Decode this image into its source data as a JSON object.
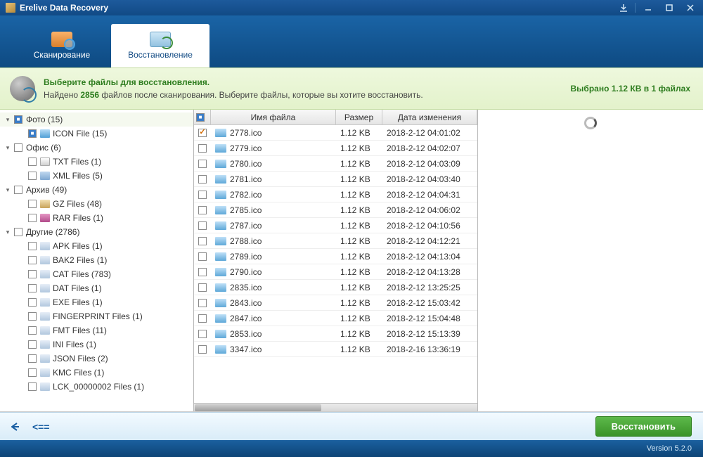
{
  "app": {
    "title": "Erelive Data Recovery",
    "version": "Version 5.2.0"
  },
  "tabs": {
    "scan": "Сканирование",
    "recover": "Восстановление"
  },
  "info": {
    "line1": "Выберите файлы для восстановления.",
    "line2a": "Найдено ",
    "count": "2856",
    "line2b": " файлов после сканирования. Выберите файлы, которые вы хотите восстановить.",
    "selected": "Выбрано 1.12 КВ в 1 файлах"
  },
  "tree": [
    {
      "level": 1,
      "exp": "▾",
      "chk": true,
      "icon": "",
      "label": "Фото (15)",
      "selected": true
    },
    {
      "level": 2,
      "exp": "",
      "chk": true,
      "icon": "ico",
      "label": "ICON File (15)"
    },
    {
      "level": 1,
      "exp": "▾",
      "chk": false,
      "icon": "",
      "label": "Офис (6)"
    },
    {
      "level": 2,
      "exp": "",
      "chk": false,
      "icon": "txt",
      "label": "TXT Files (1)"
    },
    {
      "level": 2,
      "exp": "",
      "chk": false,
      "icon": "xml",
      "label": "XML Files (5)"
    },
    {
      "level": 1,
      "exp": "▾",
      "chk": false,
      "icon": "",
      "label": "Архив (49)"
    },
    {
      "level": 2,
      "exp": "",
      "chk": false,
      "icon": "gz",
      "label": "GZ Files (48)"
    },
    {
      "level": 2,
      "exp": "",
      "chk": false,
      "icon": "rar",
      "label": "RAR Files (1)"
    },
    {
      "level": 1,
      "exp": "▾",
      "chk": false,
      "icon": "",
      "label": "Другие (2786)"
    },
    {
      "level": 2,
      "exp": "",
      "chk": false,
      "icon": "def",
      "label": "APK Files (1)"
    },
    {
      "level": 2,
      "exp": "",
      "chk": false,
      "icon": "def",
      "label": "BAK2 Files (1)"
    },
    {
      "level": 2,
      "exp": "",
      "chk": false,
      "icon": "def",
      "label": "CAT Files (783)"
    },
    {
      "level": 2,
      "exp": "",
      "chk": false,
      "icon": "def",
      "label": "DAT Files (1)"
    },
    {
      "level": 2,
      "exp": "",
      "chk": false,
      "icon": "def",
      "label": "EXE Files (1)"
    },
    {
      "level": 2,
      "exp": "",
      "chk": false,
      "icon": "def",
      "label": "FINGERPRINT Files (1)"
    },
    {
      "level": 2,
      "exp": "",
      "chk": false,
      "icon": "def",
      "label": "FMT Files (11)"
    },
    {
      "level": 2,
      "exp": "",
      "chk": false,
      "icon": "def",
      "label": "INI Files (1)"
    },
    {
      "level": 2,
      "exp": "",
      "chk": false,
      "icon": "def",
      "label": "JSON Files (2)"
    },
    {
      "level": 2,
      "exp": "",
      "chk": false,
      "icon": "def",
      "label": "KMC Files (1)"
    },
    {
      "level": 2,
      "exp": "",
      "chk": false,
      "icon": "def",
      "label": "LCK_00000002 Files (1)"
    }
  ],
  "cols": {
    "name": "Имя файла",
    "size": "Размер",
    "mdate": "Дата изменения"
  },
  "files": [
    {
      "chk": true,
      "name": "2778.ico",
      "size": "1.12 KB",
      "mdate": "2018-2-12 04:01:02"
    },
    {
      "chk": false,
      "name": "2779.ico",
      "size": "1.12 KB",
      "mdate": "2018-2-12 04:02:07"
    },
    {
      "chk": false,
      "name": "2780.ico",
      "size": "1.12 KB",
      "mdate": "2018-2-12 04:03:09"
    },
    {
      "chk": false,
      "name": "2781.ico",
      "size": "1.12 KB",
      "mdate": "2018-2-12 04:03:40"
    },
    {
      "chk": false,
      "name": "2782.ico",
      "size": "1.12 KB",
      "mdate": "2018-2-12 04:04:31"
    },
    {
      "chk": false,
      "name": "2785.ico",
      "size": "1.12 KB",
      "mdate": "2018-2-12 04:06:02"
    },
    {
      "chk": false,
      "name": "2787.ico",
      "size": "1.12 KB",
      "mdate": "2018-2-12 04:10:56"
    },
    {
      "chk": false,
      "name": "2788.ico",
      "size": "1.12 KB",
      "mdate": "2018-2-12 04:12:21"
    },
    {
      "chk": false,
      "name": "2789.ico",
      "size": "1.12 KB",
      "mdate": "2018-2-12 04:13:04"
    },
    {
      "chk": false,
      "name": "2790.ico",
      "size": "1.12 KB",
      "mdate": "2018-2-12 04:13:28"
    },
    {
      "chk": false,
      "name": "2835.ico",
      "size": "1.12 KB",
      "mdate": "2018-2-12 13:25:25"
    },
    {
      "chk": false,
      "name": "2843.ico",
      "size": "1.12 KB",
      "mdate": "2018-2-12 15:03:42"
    },
    {
      "chk": false,
      "name": "2847.ico",
      "size": "1.12 KB",
      "mdate": "2018-2-12 15:04:48"
    },
    {
      "chk": false,
      "name": "2853.ico",
      "size": "1.12 KB",
      "mdate": "2018-2-12 15:13:39"
    },
    {
      "chk": false,
      "name": "3347.ico",
      "size": "1.12 KB",
      "mdate": "2018-2-16 13:36:19"
    }
  ],
  "buttons": {
    "back": "<==",
    "recover": "Восстановить"
  }
}
